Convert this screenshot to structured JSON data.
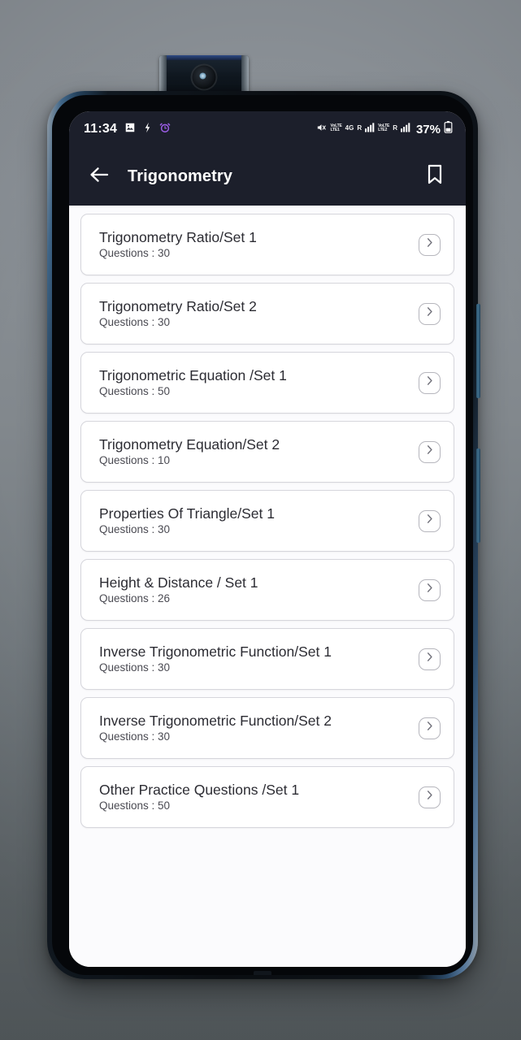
{
  "device": {
    "camera_icon": "popup-selfie-camera-icon"
  },
  "status_bar": {
    "time": "11:34",
    "icons_left": [
      "photo-icon",
      "bolt-icon",
      "alarm-icon"
    ],
    "icons_right": [
      "mute-icon",
      "volte-lte1-icon",
      "network-4g-icon",
      "signal-bars-1-icon",
      "volte-lte2-icon",
      "signal-bars-2-icon"
    ],
    "network_label": "4G",
    "volte_top": "VoLTE",
    "volte_bottom": "LTE1",
    "volte2_top": "VoLTE",
    "volte2_bottom": "LTE2",
    "roaming_label": "R",
    "battery_percent": "37%"
  },
  "app_bar": {
    "back_icon": "arrow-left-icon",
    "title": "Trigonometry",
    "bookmark_icon": "bookmark-icon"
  },
  "colors": {
    "appbar_bg": "#1c1f2b",
    "screen_bg": "#fbfbfd",
    "card_bg": "#ffffff",
    "card_border": "#d6d6dc",
    "title_text": "#2c2c33",
    "sub_text": "#4a4a52",
    "accent_alarm": "#9b5de5"
  },
  "list": {
    "chevron_icon": "chevron-right-icon",
    "items": [
      {
        "title": "Trigonometry Ratio/Set 1",
        "subtitle": "Questions : 30",
        "questions": 30
      },
      {
        "title": "Trigonometry Ratio/Set 2",
        "subtitle": "Questions : 30",
        "questions": 30
      },
      {
        "title": "Trigonometric Equation /Set 1",
        "subtitle": "Questions : 50",
        "questions": 50
      },
      {
        "title": "Trigonometry Equation/Set 2",
        "subtitle": "Questions : 10",
        "questions": 10
      },
      {
        "title": "Properties Of Triangle/Set 1",
        "subtitle": "Questions : 30",
        "questions": 30
      },
      {
        "title": "Height & Distance / Set 1",
        "subtitle": "Questions : 26",
        "questions": 26
      },
      {
        "title": "Inverse Trigonometric Function/Set 1",
        "subtitle": "Questions : 30",
        "questions": 30
      },
      {
        "title": "Inverse Trigonometric Function/Set 2",
        "subtitle": "Questions : 30",
        "questions": 30
      },
      {
        "title": "Other Practice Questions /Set 1",
        "subtitle": "Questions : 50",
        "questions": 50
      }
    ]
  }
}
